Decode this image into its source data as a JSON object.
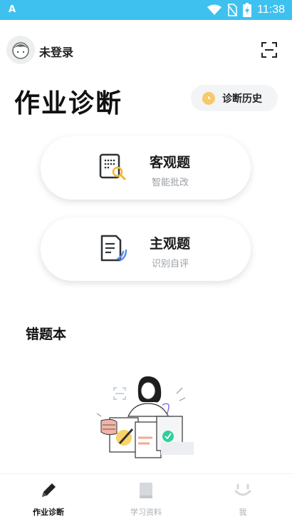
{
  "status_bar": {
    "time": "11:38",
    "left_icon": "A",
    "icons": [
      "wifi-icon",
      "no-sim-icon",
      "battery-charging-icon"
    ],
    "bg_color": "#3ec1ee"
  },
  "header": {
    "login_label": "未登录",
    "avatar_icon": "avatar-face-icon",
    "scan_icon": "scan-frame-icon"
  },
  "main": {
    "title": "作业诊断",
    "history_button": {
      "label": "诊断历史",
      "icon": "clock-icon"
    },
    "cards": [
      {
        "title": "客观题",
        "subtitle": "智能批改",
        "icon": "objective-sheet-search-icon"
      },
      {
        "title": "主观题",
        "subtitle": "识别自评",
        "icon": "subjective-document-icon"
      }
    ],
    "wrongbook_title": "错题本"
  },
  "tabbar": {
    "tabs": [
      {
        "label": "作业诊断",
        "icon": "pencil-icon",
        "active": true
      },
      {
        "label": "学习资料",
        "icon": "book-icon",
        "active": false
      },
      {
        "label": "我",
        "icon": "smiley-icon",
        "active": false
      }
    ]
  },
  "colors": {
    "accent_yellow": "#f7c96a",
    "accent_blue": "#5b8ef0",
    "text_secondary": "#9a9ea4"
  }
}
